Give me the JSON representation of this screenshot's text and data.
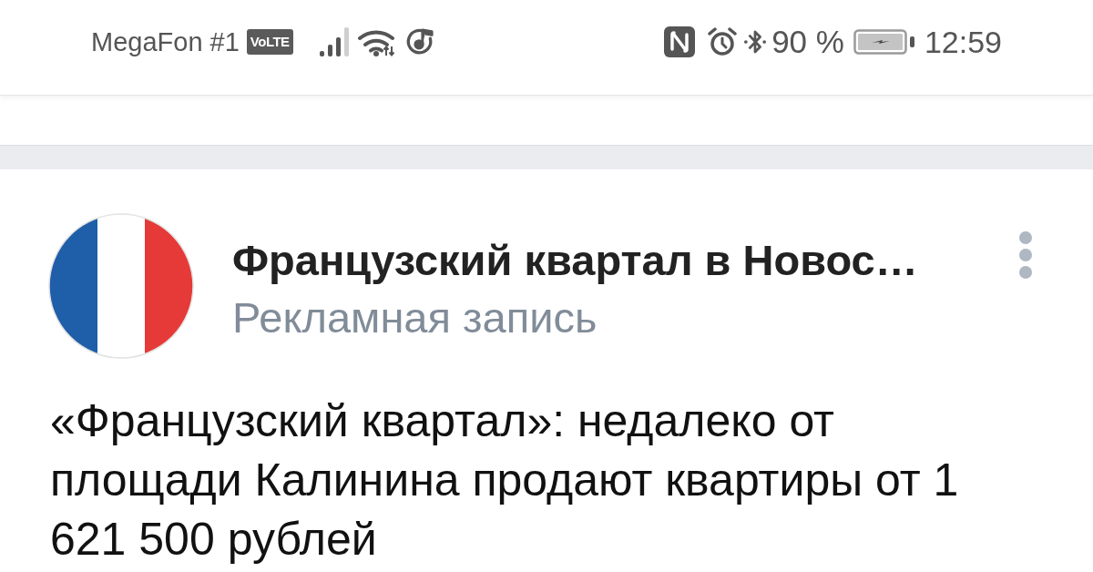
{
  "status_bar": {
    "carrier": "MegaFon #1",
    "network_badge": "VoLTE",
    "battery_percent": "90 %",
    "time": "12:59"
  },
  "post": {
    "community_name": "Французский квартал в Новос…",
    "subtitle": "Рекламная запись",
    "text": "«Французский квартал»: недалеко от площади Калинина продают квартиры от 1 621 500 рублей"
  }
}
